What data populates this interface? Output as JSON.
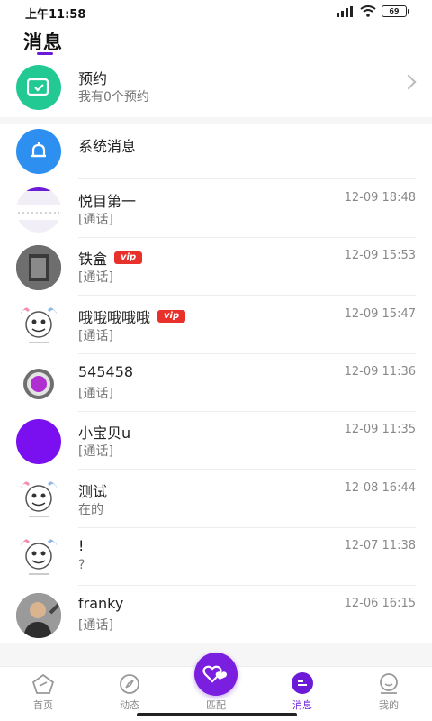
{
  "status_bar": {
    "time": "上午11:58",
    "battery": "69"
  },
  "page": {
    "title": "消息"
  },
  "appointment": {
    "title": "预约",
    "subtitle": "我有0个预约"
  },
  "system": {
    "title": "系统消息"
  },
  "conversations": [
    {
      "name": "悦目第一",
      "preview": "[通话]",
      "time": "12-09 18:48",
      "vip": false
    },
    {
      "name": "铁盒",
      "preview": "[通话]",
      "time": "12-09 15:53",
      "vip": true,
      "vip_label": "vip"
    },
    {
      "name": "哦哦哦哦哦",
      "preview": "[通话]",
      "time": "12-09 15:47",
      "vip": true,
      "vip_label": "vip"
    },
    {
      "name": "545458",
      "preview": "[通话]",
      "time": "12-09 11:36",
      "vip": false
    },
    {
      "name": "小宝贝u",
      "preview": "[通话]",
      "time": "12-09 11:35",
      "vip": false
    },
    {
      "name": "测试",
      "preview": "在的",
      "time": "12-08 16:44",
      "vip": false
    },
    {
      "name": "!",
      "preview": "?",
      "time": "12-07 11:38",
      "vip": false
    },
    {
      "name": "franky",
      "preview": "[通话]",
      "time": "12-06 16:15",
      "vip": false
    }
  ],
  "tabs": [
    {
      "label": "首页",
      "icon": "pentagon-icon"
    },
    {
      "label": "动态",
      "icon": "compass-icon"
    },
    {
      "label": "匹配",
      "icon": "hearts-icon"
    },
    {
      "label": "消息",
      "icon": "message-icon"
    },
    {
      "label": "我的",
      "icon": "profile-icon"
    }
  ],
  "colors": {
    "accent": "#6b1bd8",
    "appointment_icon": "#22c993",
    "system_icon": "#2d8ff0",
    "vip": "#e8312a"
  }
}
